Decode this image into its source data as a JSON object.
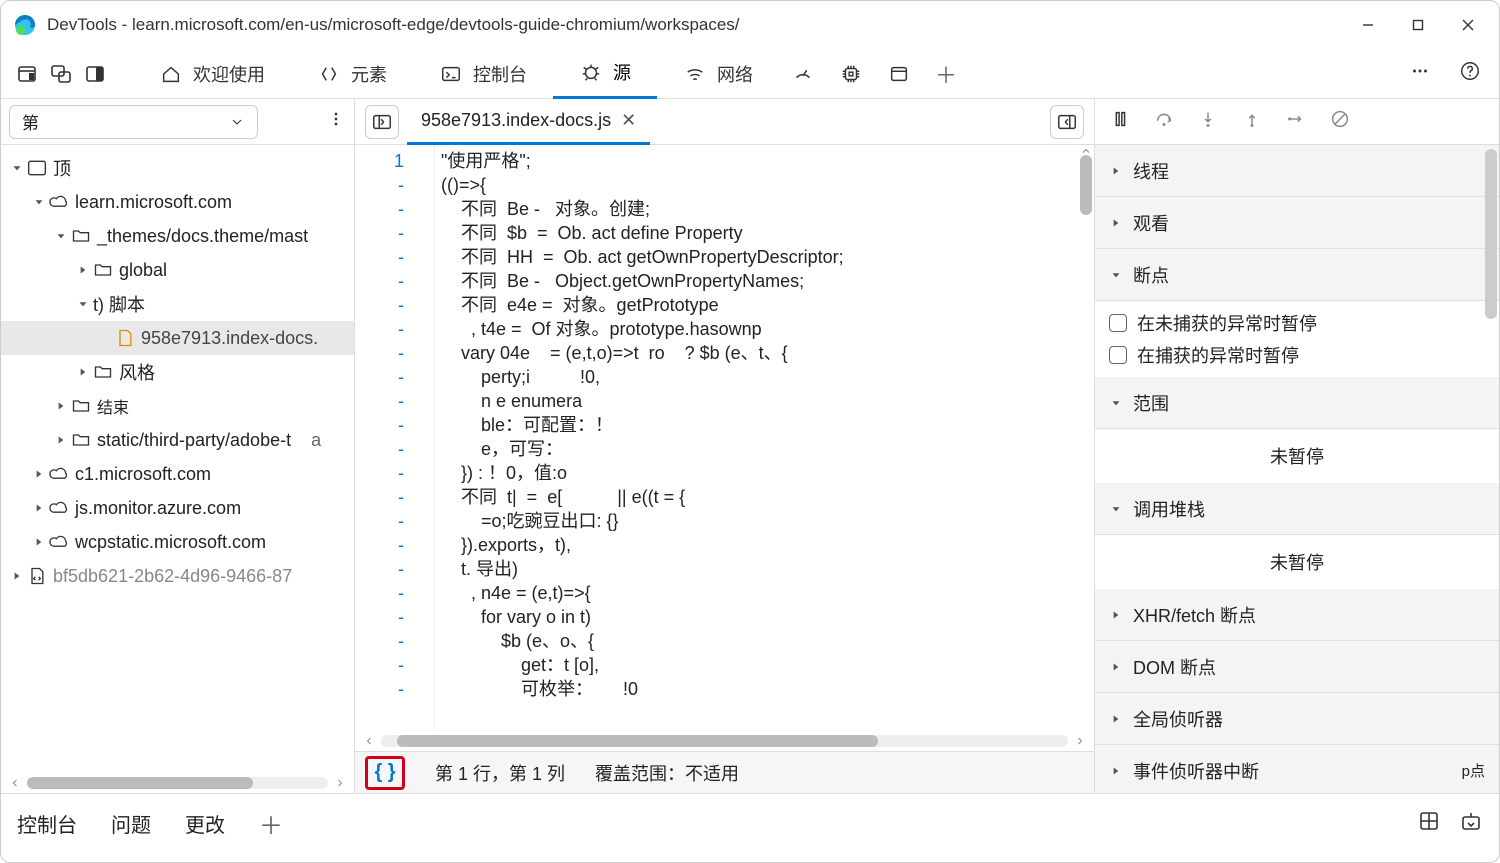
{
  "window": {
    "title": "DevTools - learn.microsoft.com/en-us/microsoft-edge/devtools-guide-chromium/workspaces/"
  },
  "tabs": {
    "welcome": "欢迎使用",
    "elements": "元素",
    "console": "控制台",
    "sources": "源",
    "network": "网络"
  },
  "navigator": {
    "dropdown": "第",
    "tree": {
      "top": "顶",
      "learn": "learn.microsoft.com",
      "themes": "_themes/docs.theme/mast",
      "global": "global",
      "scripts": "t) 脚本",
      "selected_file": "958e7913.index-docs.",
      "styles": "风格",
      "end": "结束",
      "static": "static/third-party/adobe-t",
      "static_suffix": "a",
      "c1": "c1.microsoft.com",
      "jsmon": "js.monitor.azure.com",
      "wcp": "wcpstatic.microsoft.com",
      "bf5": "bf5db621-2b62-4d96-9466-87"
    }
  },
  "editor": {
    "file_tab": "958e7913.index-docs.js",
    "gutter_first": "1",
    "gutter_dash": "-",
    "code": [
      "\"使用严格\";",
      "(()=>{",
      "    不同  Be -   对象。创建;",
      "    不同  $b  =  Ob. act define Property",
      "    不同  HH  =  Ob. act getOwnPropertyDescriptor;",
      "    不同  Be -   Object.getOwnPropertyNames;",
      "    不同  e4e =  对象。getPrototype",
      "      , t4e =  Of 对象。prototype.hasownp",
      "    vary 04e    = (e,t,o)=>t  ro    ? $b (e、t、{",
      "        perty;i          !0,",
      "        n e enumera",
      "        ble：可配置：！",
      "        e，可写：",
      "    }) : ！0，值:o",
      "    不同  t|  =  e[           || e((t = {",
      "        =o;吃豌豆出口: {}",
      "    }).exports，t),",
      "    t. 导出)",
      "      , n4e = (e,t)=>{",
      "        for vary o in t)",
      "            $b (e、o、{",
      "                get：t [o],",
      "                可枚举：      !0"
    ],
    "status": {
      "pretty": "{ }",
      "cursor": "第 1 行，第 1 列",
      "coverage": "覆盖范围：不适用"
    }
  },
  "debugger": {
    "sections": {
      "threads": "线程",
      "watch": "观看",
      "breakpoints": "断点",
      "bp_uncaught": "在未捕获的异常时暂停",
      "bp_caught": "在捕获的异常时暂停",
      "scope": "范围",
      "scope_body": "未暂停",
      "callstack": "调用堆栈",
      "callstack_body": "未暂停",
      "xhr": "XHR/fetch 断点",
      "dom": "DOM 断点",
      "global": "全局侦听器",
      "event": "事件侦听器中断",
      "event_suffix": "p点"
    }
  },
  "drawer": {
    "console": "控制台",
    "issues": "问题",
    "changes": "更改"
  }
}
